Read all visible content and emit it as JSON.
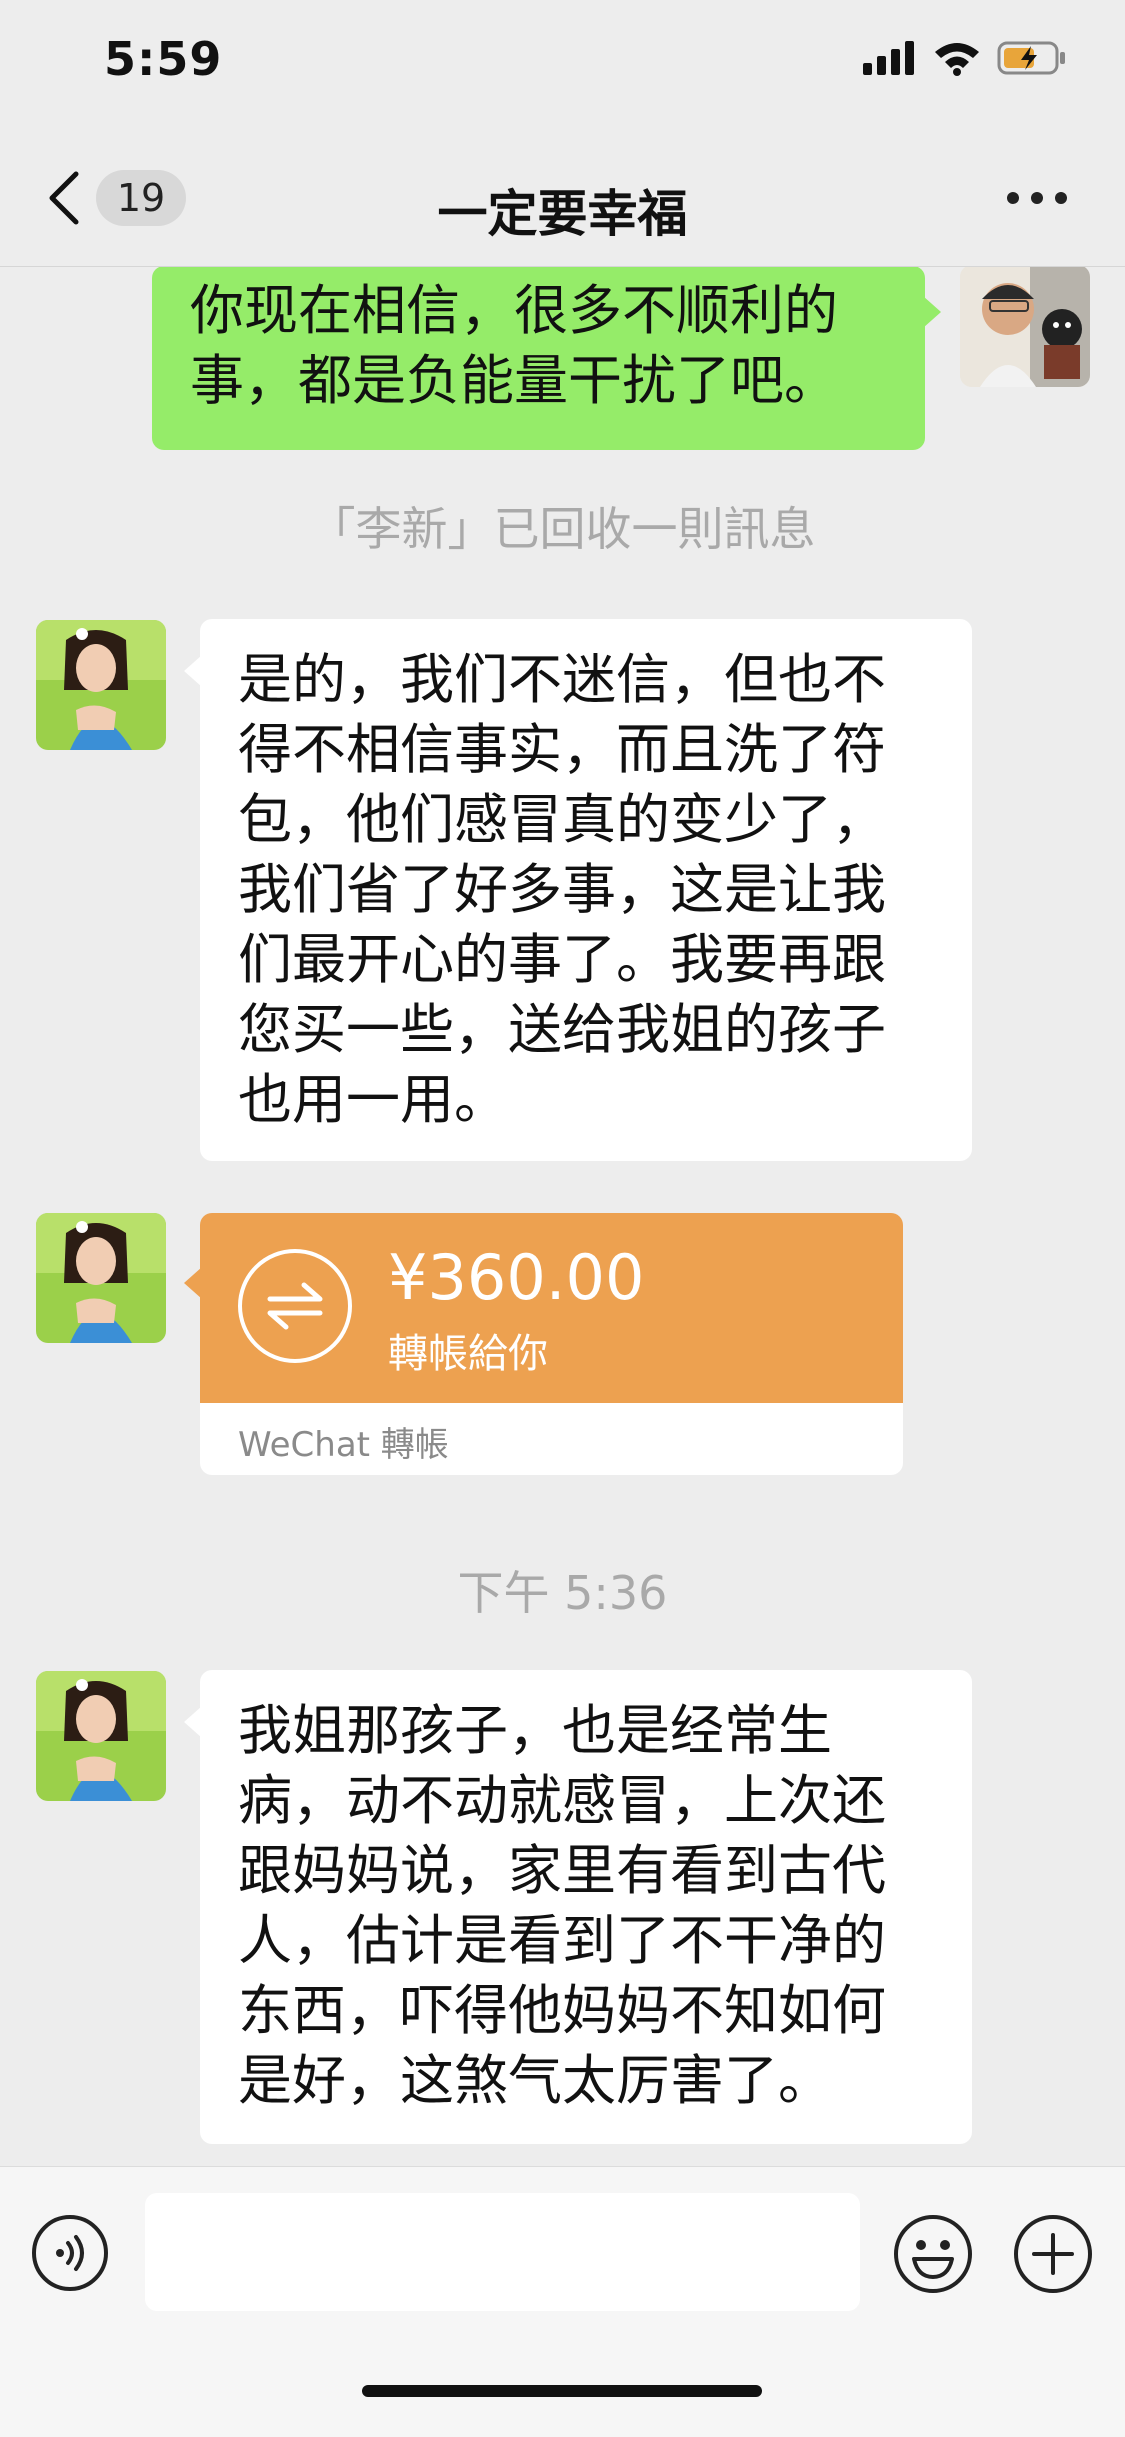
{
  "status_bar": {
    "time": "5:59",
    "battery_icon": "battery-charging-icon"
  },
  "nav": {
    "unread_count": "19",
    "title": "一定要幸福"
  },
  "messages": {
    "m1": {
      "text": "你现在相信，很多不顺利的\n事，都是负能量干扰了吧。"
    },
    "recall_notice": "「李新」已回收一則訊息",
    "m2": {
      "text": "是的，我们不迷信，但也不\n得不相信事实，而且洗了符\n包，他们感冒真的变少了，\n我们省了好多事，这是让我\n们最开心的事了。我要再跟\n您买一些，送给我姐的孩子\n也用一用。"
    },
    "transfer": {
      "amount": "¥360.00",
      "description": "轉帳給你",
      "brand": "WeChat 轉帳"
    },
    "timestamp": "下午 5:36",
    "m3": {
      "text": "我姐那孩子，也是经常生\n病，动不动就感冒，上次还\n跟妈妈说，家里有看到古代\n人，估计是看到了不干净的\n东西，吓得他妈妈不知如何\n是好，这煞气太厉害了。"
    }
  },
  "input": {
    "value": "",
    "placeholder": ""
  },
  "colors": {
    "outgoing_bubble": "#95ec69",
    "transfer": "#eda150",
    "background": "#ededed"
  }
}
